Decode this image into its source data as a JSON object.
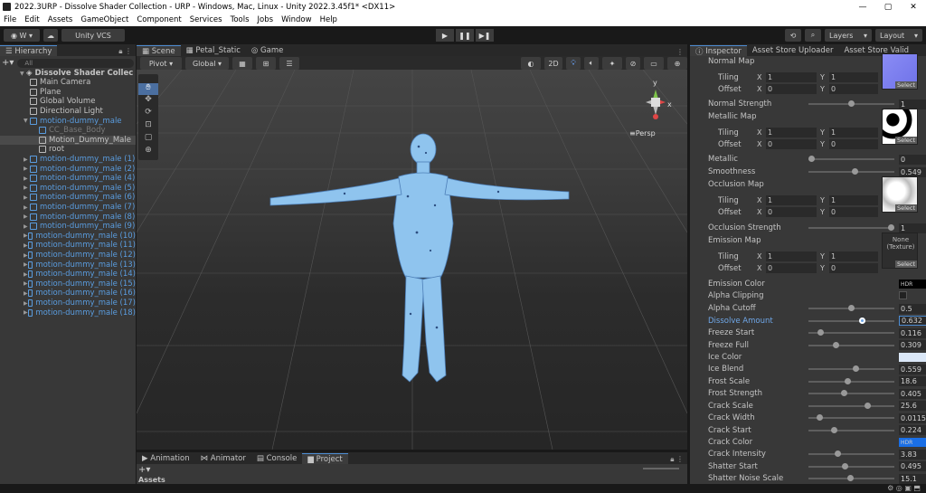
{
  "window": {
    "title": "2022.3URP - Dissolve Shader Collection - URP - Windows, Mac, Linux - Unity 2022.3.45f1* <DX11>",
    "controls": [
      "—",
      "▢",
      "✕"
    ]
  },
  "menu": [
    "File",
    "Edit",
    "Assets",
    "GameObject",
    "Component",
    "Services",
    "Tools",
    "Jobs",
    "Window",
    "Help"
  ],
  "toolbar": {
    "account": "W",
    "vcs": "Unity VCS",
    "layers": "Layers",
    "layout": "Layout"
  },
  "hierarchy": {
    "tab": "Hierarchy",
    "search_placeholder": "All",
    "scene_name": "Dissolve Shader Collec",
    "items": [
      {
        "label": "Main Camera",
        "style": "normal",
        "indent": 1
      },
      {
        "label": "Plane",
        "style": "normal",
        "indent": 1
      },
      {
        "label": "Global Volume",
        "style": "normal",
        "indent": 1
      },
      {
        "label": "Directional Light",
        "style": "normal",
        "indent": 1
      },
      {
        "label": "motion-dummy_male",
        "style": "blue",
        "indent": 1,
        "expanded": true
      },
      {
        "label": "CC_Base_Body",
        "style": "grey",
        "indent": 2
      },
      {
        "label": "Motion_Dummy_Male",
        "style": "selected",
        "indent": 2
      },
      {
        "label": "root",
        "style": "normal",
        "indent": 2
      },
      {
        "label": "motion-dummy_male (1)",
        "style": "blue",
        "indent": 1
      },
      {
        "label": "motion-dummy_male (2)",
        "style": "blue",
        "indent": 1
      },
      {
        "label": "motion-dummy_male (4)",
        "style": "blue",
        "indent": 1
      },
      {
        "label": "motion-dummy_male (5)",
        "style": "blue",
        "indent": 1
      },
      {
        "label": "motion-dummy_male (6)",
        "style": "blue",
        "indent": 1
      },
      {
        "label": "motion-dummy_male (7)",
        "style": "blue",
        "indent": 1
      },
      {
        "label": "motion-dummy_male (8)",
        "style": "blue",
        "indent": 1
      },
      {
        "label": "motion-dummy_male (9)",
        "style": "blue",
        "indent": 1
      },
      {
        "label": "motion-dummy_male (10)",
        "style": "blue",
        "indent": 1
      },
      {
        "label": "motion-dummy_male (11)",
        "style": "blue",
        "indent": 1
      },
      {
        "label": "motion-dummy_male (12)",
        "style": "blue",
        "indent": 1
      },
      {
        "label": "motion-dummy_male (13)",
        "style": "blue",
        "indent": 1
      },
      {
        "label": "motion-dummy_male (14)",
        "style": "blue",
        "indent": 1
      },
      {
        "label": "motion-dummy_male (15)",
        "style": "blue",
        "indent": 1
      },
      {
        "label": "motion-dummy_male (16)",
        "style": "blue",
        "indent": 1
      },
      {
        "label": "motion-dummy_male (17)",
        "style": "blue",
        "indent": 1
      },
      {
        "label": "motion-dummy_male (18)",
        "style": "blue",
        "indent": 1
      }
    ]
  },
  "scene": {
    "tabs": [
      "Scene",
      "Petal_Static",
      "Game"
    ],
    "pivot": "Pivot",
    "global": "Global",
    "mode_2d": "2D",
    "persp": "Persp",
    "axis_y": "y",
    "axis_x": "x"
  },
  "bottom": {
    "tabs": [
      "Animation",
      "Animator",
      "Console",
      "Project"
    ],
    "assets_label": "Assets"
  },
  "inspector": {
    "tabs": [
      "Inspector",
      "Asset Store Uploader",
      "Asset Store Valid"
    ],
    "normal_map": {
      "label": "Normal Map",
      "tiling_x": "1",
      "tiling_y": "1",
      "offset_x": "0",
      "offset_y": "0"
    },
    "normal_strength": {
      "label": "Normal Strength",
      "value": "1",
      "pos": 0.5
    },
    "metallic_map": {
      "label": "Metallic Map",
      "tiling_x": "1",
      "tiling_y": "1",
      "offset_x": "0",
      "offset_y": "0"
    },
    "metallic": {
      "label": "Metallic",
      "value": "0",
      "pos": 0.0
    },
    "smoothness": {
      "label": "Smoothness",
      "value": "0.549",
      "pos": 0.549
    },
    "occlusion_map": {
      "label": "Occlusion Map",
      "tiling_x": "1",
      "tiling_y": "1",
      "offset_x": "0",
      "offset_y": "0"
    },
    "occlusion_strength": {
      "label": "Occlusion Strength",
      "value": "1",
      "pos": 1.0
    },
    "emission_map": {
      "label": "Emission Map",
      "none_text": "None\n(Texture)",
      "tiling_x": "1",
      "tiling_y": "1",
      "offset_x": "0",
      "offset_y": "0"
    },
    "labels": {
      "tiling": "Tiling",
      "offset": "Offset",
      "x": "X",
      "y": "Y",
      "select": "Select",
      "hdr": "HDR"
    },
    "emission_color": {
      "label": "Emission Color",
      "color": "#000000"
    },
    "alpha_clipping": {
      "label": "Alpha Clipping"
    },
    "sliders": [
      {
        "label": "Alpha Cutoff",
        "value": "0.5",
        "pos": 0.5
      },
      {
        "label": "Dissolve Amount",
        "value": "0.632",
        "pos": 0.632,
        "active": true
      },
      {
        "label": "Freeze Start",
        "value": "0.116",
        "pos": 0.116
      },
      {
        "label": "Freeze Full",
        "value": "0.309",
        "pos": 0.309
      }
    ],
    "ice_color": {
      "label": "Ice Color",
      "color": "#dbe8f8"
    },
    "sliders2": [
      {
        "label": "Ice Blend",
        "value": "0.559",
        "pos": 0.559
      },
      {
        "label": "Frost Scale",
        "value": "18.6",
        "pos": 0.46
      },
      {
        "label": "Frost Strength",
        "value": "0.405",
        "pos": 0.405
      },
      {
        "label": "Crack Scale",
        "value": "25.6",
        "pos": 0.7
      },
      {
        "label": "Crack Width",
        "value": "0.0115",
        "pos": 0.1
      },
      {
        "label": "Crack Start",
        "value": "0.224",
        "pos": 0.28
      }
    ],
    "crack_color": {
      "label": "Crack Color",
      "color": "#1a6fe6"
    },
    "sliders3": [
      {
        "label": "Crack Intensity",
        "value": "3.83",
        "pos": 0.33
      },
      {
        "label": "Shatter Start",
        "value": "0.495",
        "pos": 0.42
      },
      {
        "label": "Shatter Noise Scale",
        "value": "15.1",
        "pos": 0.49
      }
    ]
  }
}
